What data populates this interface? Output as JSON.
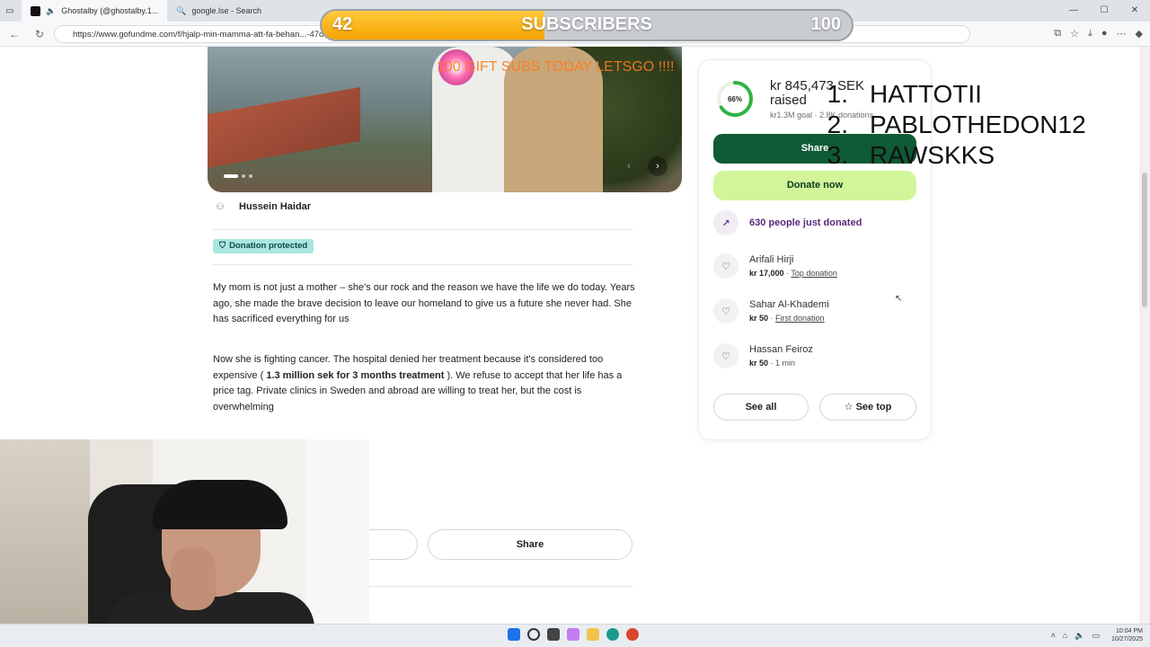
{
  "browser": {
    "tabs": [
      {
        "label": "Ghostalby (@ghostalby.1...",
        "active": true
      },
      {
        "label": "google.lse - Search",
        "active": false
      }
    ],
    "url": "https://www.gofundme.com/f/hjalp-min-mamma-att-fa-behan...-47d9-8619-d138545a7fb1&lang=en_US&ts=1757606941&utm_campaign=fp_sharesheet&utm_...",
    "window_controls": {
      "minimize": "—",
      "maximize": "☐",
      "close": "✕"
    }
  },
  "campaign": {
    "organizer": "Hussein Haidar",
    "protected_badge": "Donation protected",
    "story": {
      "p1": "My mom is not just a mother – she's our rock and the reason we have the life we do today. Years ago, she made the brave decision to leave our homeland to give us a future she never had. She has sacrificed everything for us",
      "p2_start": "Now she is fighting cancer. The hospital denied her treatment because it's considered too expensive (",
      "p2_bold": " 1.3 million sek for 3 months treatment ",
      "p2_end": "). We refuse to accept that her life has a price tag. Private clinics in Sweden and abroad are willing to treat her, but the cost is overwhelming"
    },
    "bottom_share_label": "Share"
  },
  "donation_card": {
    "progress_percent": 66,
    "progress_label": "66%",
    "raised_amount": "kr 845,473 SEK raised",
    "goal_text": "kr1.3M goal · 2.8K donations",
    "share_label": "Share",
    "donate_label": "Donate now",
    "recent_text": "630 people just donated",
    "donors": [
      {
        "name": "Arifali Hirji",
        "amount": "kr 17,000",
        "tag": "Top donation",
        "tag_link": true
      },
      {
        "name": "Sahar Al-Khademi",
        "amount": "kr 50",
        "tag": "First donation",
        "tag_link": true
      },
      {
        "name": "Hassan Feiroz",
        "amount": "kr 50",
        "tag": "1 min",
        "tag_link": false
      }
    ],
    "see_all_label": "See all",
    "see_top_label": "See top"
  },
  "stream_overlay": {
    "subscriber_goal": {
      "current": "42",
      "target": "100",
      "title": "SUBSCRIBERS",
      "fill_fraction": 0.42
    },
    "gift_text": "100 GIFT SUBS TODAY LETSGO !!!!",
    "leaderboard": [
      {
        "rank": "1.",
        "name": "HATTOTII"
      },
      {
        "rank": "2.",
        "name": "PABLOTHEDON12"
      },
      {
        "rank": "3.",
        "name": "RAWSKKS"
      }
    ]
  },
  "taskbar": {
    "time": "10:04 PM",
    "date": "10/27/2025"
  },
  "colors": {
    "accent_green": "#0e5b36",
    "donate_lime": "#d2f59a",
    "progress_green": "#2fb344",
    "overlay_gold": "#f5a300",
    "gift_orange": "#ff7a1a"
  }
}
